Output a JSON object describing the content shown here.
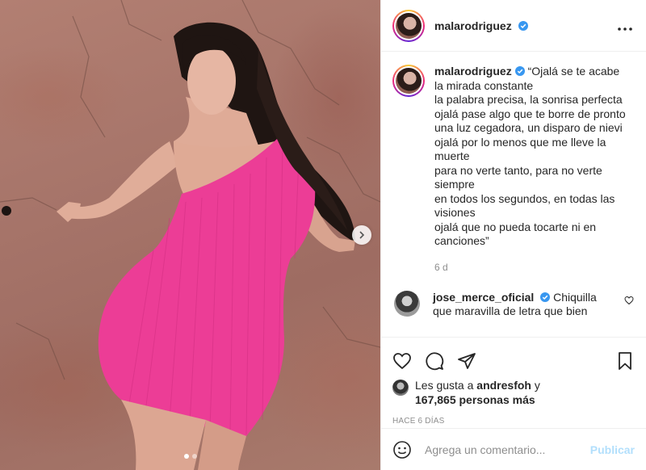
{
  "post": {
    "author": {
      "username": "malarodriguez",
      "verified": true
    },
    "header_more_icon": "more-horizontal-icon",
    "caption": {
      "username": "malarodriguez",
      "text": "“Ojalá se te acabe\nla mirada constante\nla palabra precisa, la sonrisa perfecta\nojalá pase algo que te borre de pronto\nuna luz cegadora, un disparo de nievi\nojalá por lo menos que me lleve la muerte\npara no verte tanto, para no verte siempre\nen todos los segundos, en todas las visiones\nojalá que no pueda tocarte ni en canciones”",
      "time": "6 d"
    },
    "comments": [
      {
        "username": "jose_merce_oficial",
        "verified": true,
        "text": "Chiquilla que maravilla de letra que bien"
      }
    ],
    "actions": {
      "like_icon": "heart-icon",
      "comment_icon": "comment-icon",
      "share_icon": "paper-plane-icon",
      "save_icon": "bookmark-icon"
    },
    "likes": {
      "prefix": "Les gusta a",
      "user": "andresfoh",
      "and": "y",
      "count_text": "167,865 personas más"
    },
    "time_ago": "HACE 6 DÍAS",
    "add_comment": {
      "placeholder": "Agrega un comentario...",
      "post_label": "Publicar",
      "emoji_icon": "smiley-icon"
    },
    "carousel": {
      "total": 2,
      "current": 1,
      "next_icon": "chevron-right-icon"
    },
    "colors": {
      "verified_blue": "#3897f0",
      "dress_pink": "#ec3d96",
      "wall": "#a7756a",
      "post_button_disabled": "#b2dffc",
      "secondary_text": "#8e8e8e"
    }
  }
}
